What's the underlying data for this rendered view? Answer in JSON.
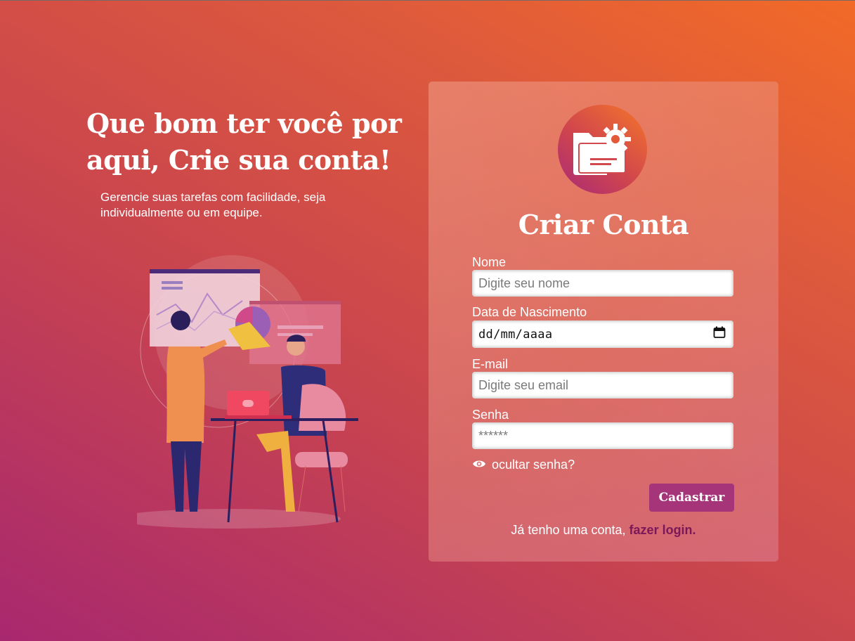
{
  "hero": {
    "title": "Que bom ter você por aqui, Crie sua conta!",
    "subtitle": "Gerencie suas tarefas com facilidade, seja individualmente ou em equipe."
  },
  "form": {
    "title": "Criar Conta",
    "name_label": "Nome",
    "name_placeholder": "Digite seu nome",
    "birth_label": "Data de Nascimento",
    "birth_placeholder": "dd/mm/aaaa",
    "email_label": "E-mail",
    "email_placeholder": "Digite seu email",
    "password_label": "Senha",
    "password_placeholder": "******",
    "toggle_password": "ocultar senha?",
    "submit": "Cadastrar",
    "login_prompt": "Já tenho uma conta,",
    "login_link": "fazer login."
  },
  "icons": {
    "logo": "folder-settings-icon",
    "toggle": "eye-icon",
    "calendar": "calendar-icon"
  },
  "colors": {
    "accent": "#a63479",
    "link": "#7a1858",
    "gradient_start": "#a8286f",
    "gradient_end": "#f26a27"
  }
}
